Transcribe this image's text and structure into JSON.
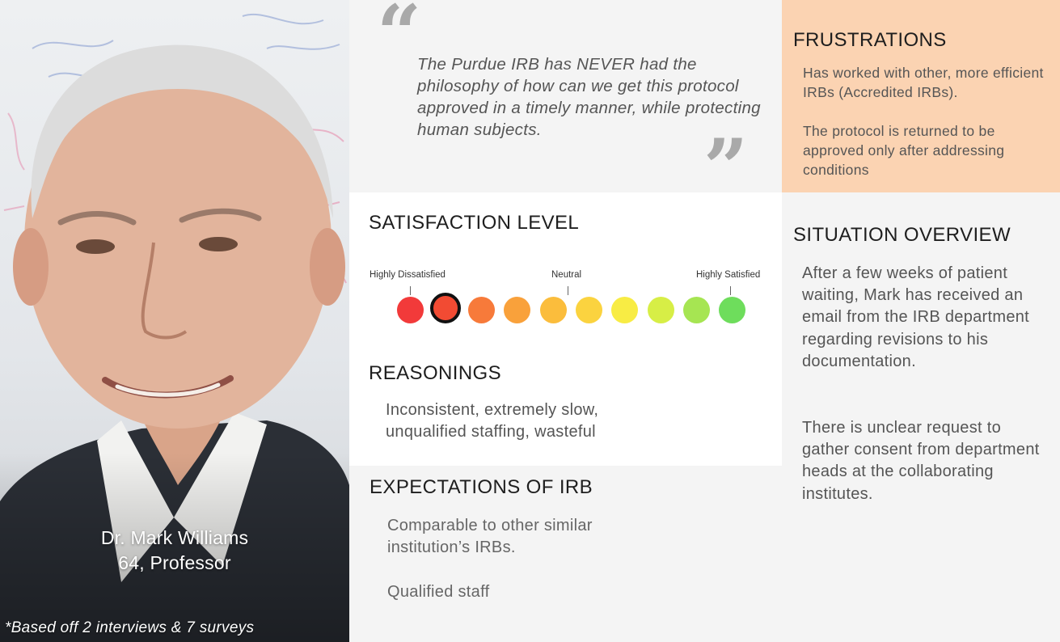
{
  "persona": {
    "name": "Dr. Mark Williams",
    "subtitle": "64, Professor",
    "footnote": "*Based off 2 interviews & 7 surveys"
  },
  "quote": {
    "open_mark": "“",
    "close_mark": "”",
    "text": "The Purdue IRB has NEVER had the philosophy of how can we get this protocol approved in a timely manner, while protecting human subjects."
  },
  "satisfaction": {
    "title": "SATISFACTION LEVEL",
    "scale_labels": {
      "low": "Highly Dissatisfied",
      "mid": "Neutral",
      "high": "Highly Satisfied"
    },
    "scale_colors": [
      "#f23a3a",
      "#f24b33",
      "#f77a3a",
      "#f9a13b",
      "#fbbd3c",
      "#fbd33f",
      "#f8ec44",
      "#d7ee46",
      "#a6e552",
      "#6edd5c"
    ],
    "selected_level": 2,
    "levels": 10
  },
  "reasonings": {
    "title": "REASONINGS",
    "text": "Inconsistent, extremely slow, unqualified staffing, wasteful"
  },
  "expectations": {
    "title": "EXPECTATIONS OF IRB",
    "items": [
      "Comparable to other similar institution’s IRBs.",
      "Qualified staff"
    ]
  },
  "frustrations": {
    "title": "FRUSTRATIONS",
    "items": [
      "Has worked with other, more efficient IRBs (Accredited IRBs).",
      "The protocol is returned to be approved only after addressing conditions"
    ]
  },
  "situation": {
    "title": "SITUATION OVERVIEW",
    "paragraphs": [
      "After a few weeks of patient waiting, Mark has received an email from the IRB department regarding revisions to his documentation.",
      "There is unclear request to gather consent from department heads at the collaborating institutes."
    ]
  }
}
